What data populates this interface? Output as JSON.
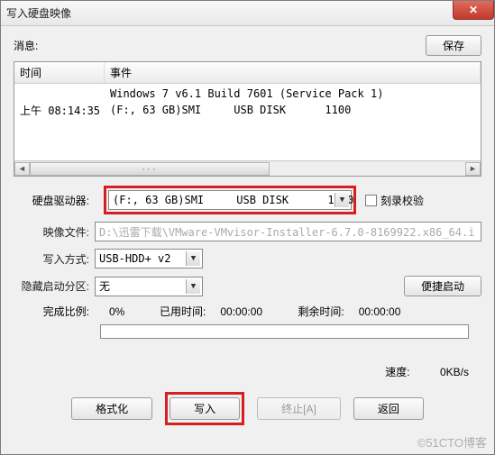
{
  "window": {
    "title": "写入硬盘映像"
  },
  "toolbar": {
    "msg_label": "消息:",
    "save_label": "保存"
  },
  "log": {
    "col_time": "时间",
    "col_event": "事件",
    "rows": [
      {
        "time": "",
        "event": "Windows 7 v6.1 Build 7601 (Service Pack 1)"
      },
      {
        "time": "上午 08:14:35",
        "event": "(F:, 63 GB)SMI     USB DISK      1100"
      }
    ]
  },
  "drive": {
    "label": "硬盘驱动器:",
    "value": "(F:, 63 GB)SMI     USB DISK      1100",
    "verify_label": "刻录校验"
  },
  "image": {
    "label": "映像文件:",
    "path": "D:\\迅雷下载\\VMware-VMvisor-Installer-6.7.0-8169922.x86_64.i"
  },
  "writemode": {
    "label": "写入方式:",
    "value": "USB-HDD+ v2"
  },
  "hidden": {
    "label": "隐藏启动分区:",
    "value": "无",
    "portable_btn": "便捷启动"
  },
  "progress": {
    "label": "完成比例:",
    "percent": "0%",
    "elapsed_label": "已用时间:",
    "elapsed": "00:00:00",
    "remain_label": "剩余时间:",
    "remain": "00:00:00"
  },
  "speed": {
    "label": "速度:",
    "value": "0KB/s"
  },
  "buttons": {
    "format": "格式化",
    "write": "写入",
    "abort": "终止[A]",
    "back": "返回"
  },
  "watermark": "©51CTO博客"
}
